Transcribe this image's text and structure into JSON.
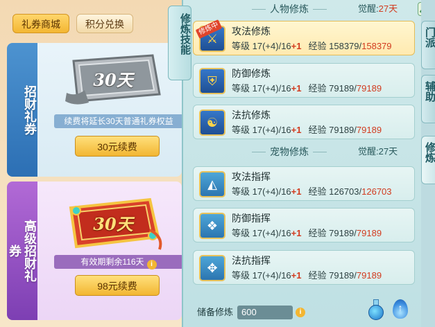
{
  "left_panel": {
    "tabs": [
      {
        "label": "礼券商城",
        "active": true
      },
      {
        "label": "积分兑换",
        "active": false
      }
    ],
    "cards": [
      {
        "side_label": "招财礼券",
        "ticket_text": "30天",
        "info": "续费将延长30天普通礼券权益",
        "button": "30元续费"
      },
      {
        "side_label": "高级招财礼券",
        "ticket_text": "30天",
        "info": "有效期剩余116天",
        "info_icon": "i",
        "button": "98元续费"
      }
    ]
  },
  "skills_panel": {
    "tab_label": "修炼技能",
    "character_section": {
      "title": "人物修炼",
      "awake_label": "觉醒:",
      "awake_value": "27天"
    },
    "pet_section": {
      "title": "宠物修炼",
      "awake_label": "觉醒:",
      "awake_value": "27天"
    },
    "character_skills": [
      {
        "name": "攻法修炼",
        "icon": "sword-icon",
        "badge": "修炼中",
        "level_label": "等级",
        "level": "17(+4)/16",
        "plus": "+1",
        "exp_label": "经验",
        "exp_current": "158379",
        "exp_max": "158379",
        "active": true
      },
      {
        "name": "防御修炼",
        "icon": "shield-icon",
        "level_label": "等级",
        "level": "17(+4)/16",
        "plus": "+1",
        "exp_label": "经验",
        "exp_current": "79189",
        "exp_max": "79189"
      },
      {
        "name": "法抗修炼",
        "icon": "yin-yang-icon",
        "level_label": "等级",
        "level": "17(+4)/16",
        "plus": "+1",
        "exp_label": "经验",
        "exp_current": "79189",
        "exp_max": "79189"
      }
    ],
    "pet_skills": [
      {
        "name": "攻法指挥",
        "icon": "claw-attack-icon",
        "level_label": "等级",
        "level": "17(+4)/16",
        "plus": "+1",
        "exp_label": "经验",
        "exp_current": "126703",
        "exp_max": "126703"
      },
      {
        "name": "防御指挥",
        "icon": "paw-shield-icon",
        "level_label": "等级",
        "level": "17(+4)/16",
        "plus": "+1",
        "exp_label": "经验",
        "exp_current": "79189",
        "exp_max": "79189"
      },
      {
        "name": "法抗指挥",
        "icon": "paw-magic-icon",
        "level_label": "等级",
        "level": "17(+4)/16",
        "plus": "+1",
        "exp_label": "经验",
        "exp_current": "79189",
        "exp_max": "79189"
      }
    ],
    "reserve": {
      "label": "储备修炼",
      "value": "600",
      "info_icon": "i"
    }
  },
  "right_tabs": [
    {
      "label": "门派"
    },
    {
      "label": "辅助"
    },
    {
      "label": "修炼",
      "active": true
    }
  ],
  "colors": {
    "accent_gold": "#f3b632",
    "value_red": "#d23b1f",
    "panel_teal": "#bfe0e3",
    "coupon_blue": "#2c6fb4",
    "coupon_purple": "#7d3fb3"
  }
}
